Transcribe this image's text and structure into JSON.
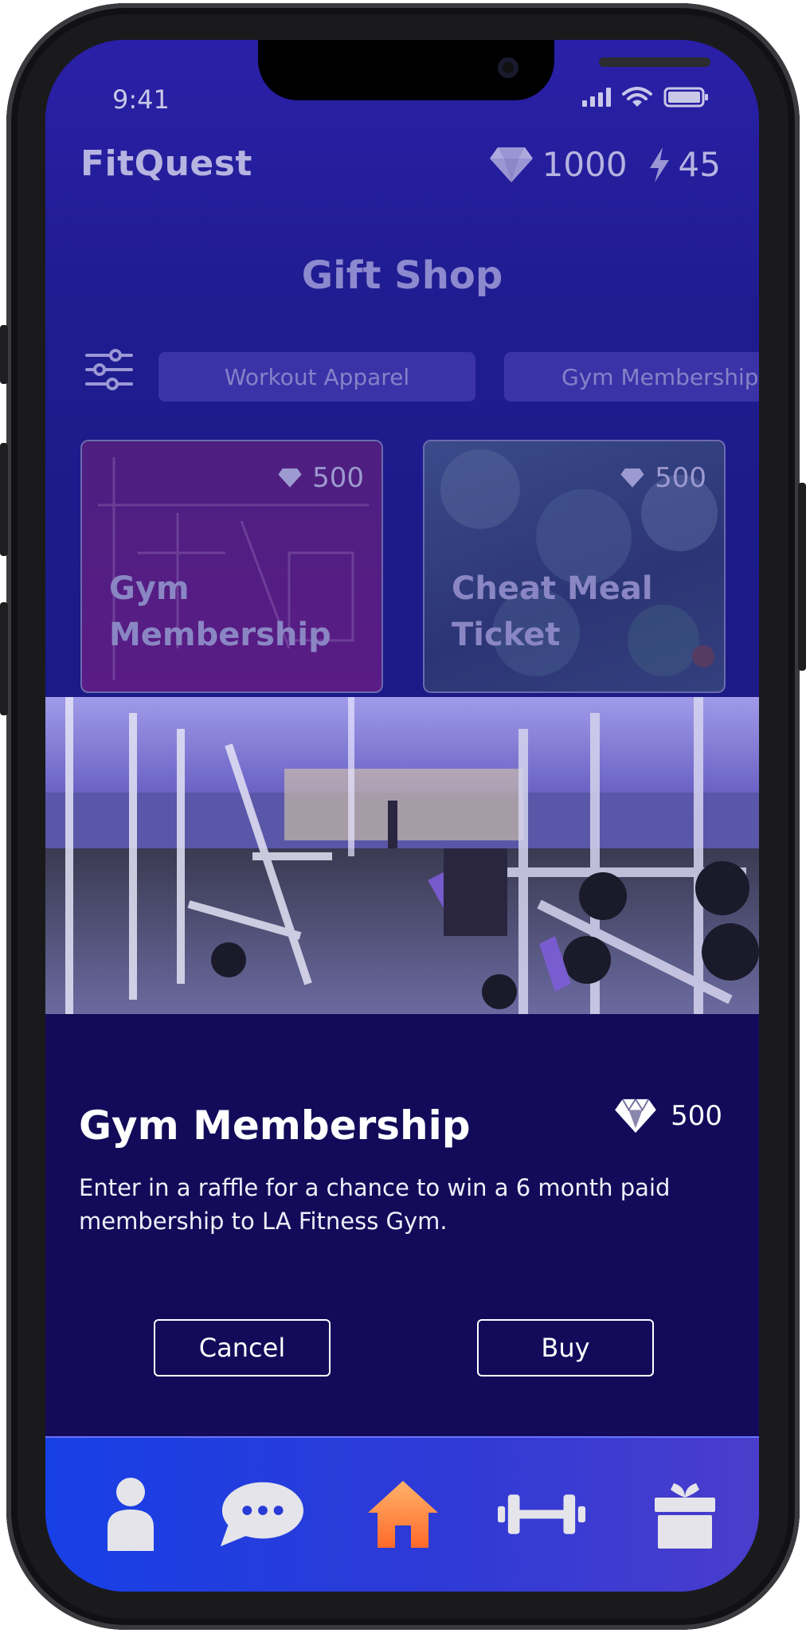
{
  "status_bar": {
    "time": "9:41"
  },
  "header": {
    "app_title": "FitQuest",
    "gems": "1000",
    "energy": "45"
  },
  "page_title": "Gift Shop",
  "filters": {
    "chips": [
      "Workout Apparel",
      "Gym Membership"
    ]
  },
  "shop_items": [
    {
      "name_line1": "Gym",
      "name_line2": "Membership",
      "price": "500"
    },
    {
      "name_line1": "Cheat Meal",
      "name_line2": "Ticket",
      "price": "500"
    }
  ],
  "detail": {
    "title": "Gym Membership",
    "price": "500",
    "description": "Enter in a raffle for a chance to win a 6 month paid membership to LA Fitness Gym.",
    "cancel_label": "Cancel",
    "buy_label": "Buy"
  },
  "nav": {
    "items": [
      "profile-icon",
      "chat-icon",
      "home-icon",
      "dumbbell-icon",
      "gift-icon"
    ]
  },
  "colors": {
    "background_dim": "#1f1c90",
    "detail_bg": "#130b59",
    "nav_start": "#1740e6",
    "nav_end": "#4a3dcc",
    "home_accent": "#ff8a3d"
  }
}
